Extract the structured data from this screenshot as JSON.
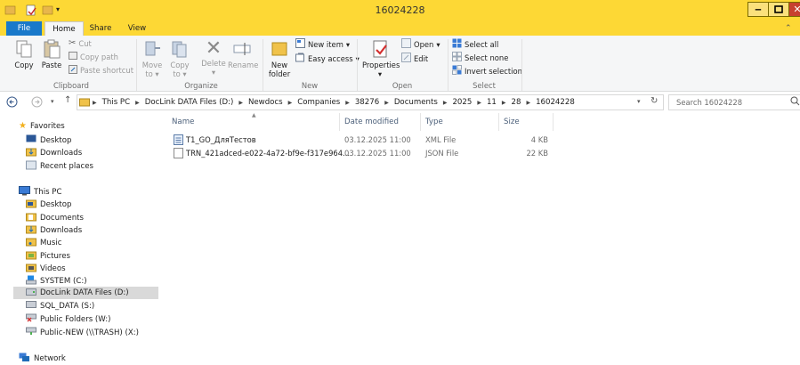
{
  "window": {
    "title": "16024228"
  },
  "tabs": {
    "file": "File",
    "home": "Home",
    "share": "Share",
    "view": "View"
  },
  "ribbon": {
    "clipboard": {
      "copy": "Copy",
      "paste": "Paste",
      "cut": "Cut",
      "copy_path": "Copy path",
      "paste_shortcut": "Paste shortcut",
      "label": "Clipboard"
    },
    "organize": {
      "move_to_1": "Move",
      "move_to_2": "to",
      "copy_to_1": "Copy",
      "copy_to_2": "to",
      "delete": "Delete",
      "rename": "Rename",
      "label": "Organize"
    },
    "new": {
      "new_item": "New item",
      "easy_access": "Easy access",
      "new_folder_1": "New",
      "new_folder_2": "folder",
      "label": "New"
    },
    "open": {
      "properties": "Properties",
      "open": "Open",
      "edit": "Edit",
      "label": "Open"
    },
    "select": {
      "select_all": "Select all",
      "select_none": "Select none",
      "invert": "Invert selection",
      "label": "Select"
    }
  },
  "address": {
    "crumbs": [
      "This PC",
      "DocLink DATA Files (D:)",
      "Newdocs",
      "Companies",
      "38276",
      "Documents",
      "2025",
      "11",
      "28",
      "16024228"
    ],
    "search_placeholder": "Search 16024228"
  },
  "nav": {
    "favorites": "Favorites",
    "fav_items": [
      "Desktop",
      "Downloads",
      "Recent places"
    ],
    "this_pc": "This PC",
    "pc_items": [
      "Desktop",
      "Documents",
      "Downloads",
      "Music",
      "Pictures",
      "Videos",
      "SYSTEM (C:)",
      "DocLink DATA Files (D:)",
      "SQL_DATA (S:)",
      "Public Folders (W:)",
      "Public-NEW (\\\\TRASH) (X:)"
    ],
    "network": "Network"
  },
  "columns": {
    "name": "Name",
    "date": "Date modified",
    "type": "Type",
    "size": "Size"
  },
  "files": [
    {
      "name": "T1_GO_ДляТестов",
      "date": "03.12.2025 11:00",
      "type": "XML File",
      "size": "4 KB"
    },
    {
      "name": "TRN_421adced-e022-4a72-bf9e-f317e964...",
      "date": "03.12.2025 11:00",
      "type": "JSON File",
      "size": "22 KB"
    }
  ],
  "colors": {
    "titlebar": "#fdd835",
    "file_tab": "#1979ca",
    "ribbon": "#f5f6f7"
  }
}
